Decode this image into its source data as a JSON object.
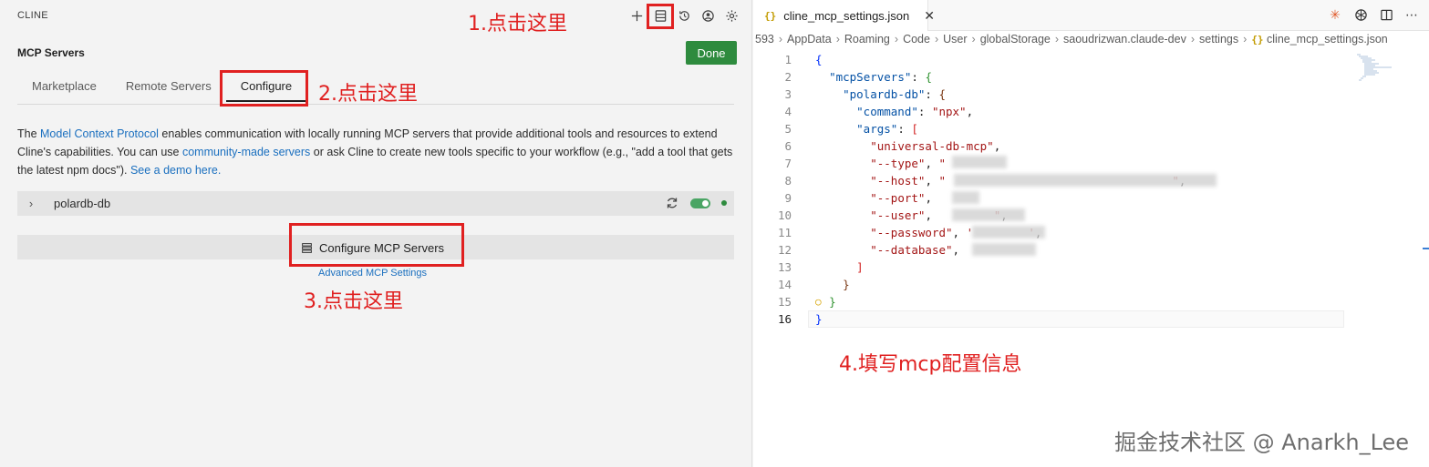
{
  "left_panel": {
    "app_title": "CLINE",
    "section_title": "MCP Servers",
    "done_label": "Done",
    "tabs": [
      {
        "label": "Marketplace"
      },
      {
        "label": "Remote Servers"
      },
      {
        "label": "Configure"
      }
    ],
    "active_tab": "Configure",
    "description": {
      "t1": "The ",
      "link1": "Model Context Protocol",
      "t2": " enables communication with locally running MCP servers that provide additional tools and resources to extend Cline's capabilities. You can use ",
      "link2": "community-made servers",
      "t3": " or ask Cline to create new tools specific to your workflow (e.g., \"add a tool that gets the latest npm docs\"). ",
      "link3": "See a demo here."
    },
    "server": {
      "name": "polardb-db",
      "enabled": true
    },
    "configure_button_label": "Configure MCP Servers",
    "advanced_link": "Advanced MCP Settings"
  },
  "annotations": {
    "step1": "1.点击这里",
    "step2": "2.点击这里",
    "step3": "3.点击这里",
    "step4": "4.填写mcp配置信息"
  },
  "editor": {
    "file_tab": "cline_mcp_settings.json",
    "breadcrumb": [
      "593",
      "AppData",
      "Roaming",
      "Code",
      "User",
      "globalStorage",
      "saoudrizwan.claude-dev",
      "settings",
      "cline_mcp_settings.json"
    ],
    "current_line": 16,
    "lines": [
      {
        "n": "1",
        "indent": "",
        "tokens": [
          [
            "b1",
            "{"
          ]
        ]
      },
      {
        "n": "2",
        "indent": "  ",
        "tokens": [
          [
            "k",
            "\"mcpServers\""
          ],
          [
            "p",
            ": "
          ],
          [
            "b2",
            "{"
          ]
        ]
      },
      {
        "n": "3",
        "indent": "    ",
        "tokens": [
          [
            "k",
            "\"polardb-db\""
          ],
          [
            "p",
            ": "
          ],
          [
            "b3",
            "{"
          ]
        ]
      },
      {
        "n": "4",
        "indent": "      ",
        "tokens": [
          [
            "k",
            "\"command\""
          ],
          [
            "p",
            ": "
          ],
          [
            "s",
            "\"npx\""
          ],
          [
            "p",
            ","
          ]
        ]
      },
      {
        "n": "5",
        "indent": "      ",
        "tokens": [
          [
            "k",
            "\"args\""
          ],
          [
            "p",
            ": "
          ],
          [
            "b4",
            "["
          ]
        ]
      },
      {
        "n": "6",
        "indent": "        ",
        "tokens": [
          [
            "s",
            "\"universal-db-mcp\""
          ],
          [
            "p",
            ","
          ]
        ]
      },
      {
        "n": "7",
        "indent": "        ",
        "tokens": [
          [
            "s",
            "\"--type\""
          ],
          [
            "p",
            ", "
          ],
          [
            "s",
            "\""
          ]
        ]
      },
      {
        "n": "8",
        "indent": "        ",
        "tokens": [
          [
            "s",
            "\"--host\""
          ],
          [
            "p",
            ", "
          ],
          [
            "s",
            "\"                                 \""
          ],
          [
            "p",
            ","
          ]
        ]
      },
      {
        "n": "9",
        "indent": "        ",
        "tokens": [
          [
            "s",
            "\"--port\""
          ],
          [
            "p",
            ","
          ]
        ]
      },
      {
        "n": "10",
        "indent": "        ",
        "tokens": [
          [
            "s",
            "\"--user\""
          ],
          [
            "p",
            ",         "
          ],
          [
            "s",
            "\""
          ],
          [
            "p",
            ","
          ]
        ]
      },
      {
        "n": "11",
        "indent": "        ",
        "tokens": [
          [
            "s",
            "\"--password\""
          ],
          [
            "p",
            ", "
          ],
          [
            "s",
            "'        '"
          ],
          [
            "p",
            ","
          ]
        ]
      },
      {
        "n": "12",
        "indent": "        ",
        "tokens": [
          [
            "s",
            "\"--database\""
          ],
          [
            "p",
            ","
          ]
        ]
      },
      {
        "n": "13",
        "indent": "      ",
        "tokens": [
          [
            "b4",
            "]"
          ]
        ]
      },
      {
        "n": "14",
        "indent": "    ",
        "tokens": [
          [
            "b3",
            "}"
          ]
        ]
      },
      {
        "n": "15",
        "indent": "  ",
        "tokens": [
          [
            "b2",
            "}"
          ]
        ]
      },
      {
        "n": "16",
        "indent": "",
        "tokens": [
          [
            "b1",
            "}"
          ]
        ]
      }
    ]
  },
  "watermark": "掘金技术社区 @ Anarkh_Lee",
  "colors": {
    "done_green": "#2e8b3e",
    "link_blue": "#1a6fbf",
    "annotation_red": "#e02020",
    "json_key": "#0451a5",
    "json_string": "#a31515"
  }
}
